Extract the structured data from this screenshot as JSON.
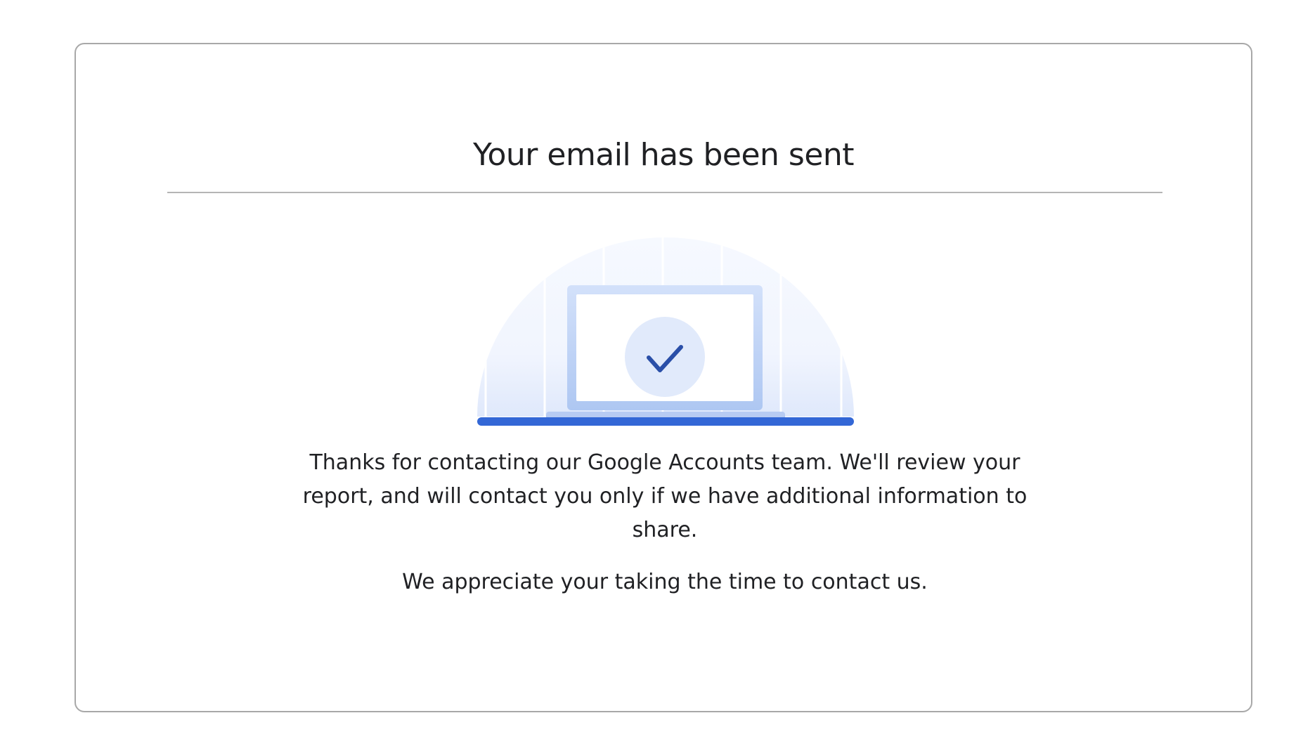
{
  "confirmation": {
    "title": "Your email has been sent",
    "illustration_icon": "laptop-checkmark-icon",
    "message": "Thanks for contacting our Google Accounts team. We'll review your report, and will contact you only if we have additional information to share.",
    "appreciation": "We appreciate your taking the time to contact us."
  },
  "colors": {
    "accent": "#3367d6",
    "check": "#2a4fa8",
    "laptop_frame": "#c5d8f7",
    "circle_bg": "#e1eafb",
    "title_text": "#202124",
    "border": "#a8a8a8"
  }
}
